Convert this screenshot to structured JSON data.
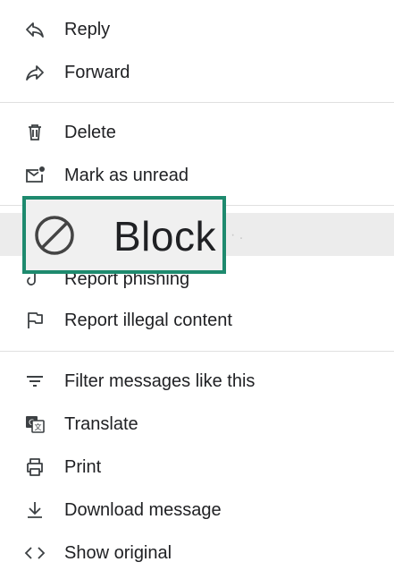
{
  "menu": {
    "items": [
      {
        "label": "Reply",
        "icon": "reply-icon"
      },
      {
        "label": "Forward",
        "icon": "forward-icon"
      },
      {
        "label": "Delete",
        "icon": "trash-icon"
      },
      {
        "label": "Mark as unread",
        "icon": "mark-unread-icon"
      },
      {
        "label": "Block",
        "icon": "block-icon"
      },
      {
        "label": "Report phishing",
        "icon": "phishing-icon"
      },
      {
        "label": "Report illegal content",
        "icon": "flag-icon"
      },
      {
        "label": "Filter messages like this",
        "icon": "filter-icon"
      },
      {
        "label": "Translate",
        "icon": "translate-icon"
      },
      {
        "label": "Print",
        "icon": "print-icon"
      },
      {
        "label": "Download message",
        "icon": "download-icon"
      },
      {
        "label": "Show original",
        "icon": "code-icon"
      }
    ]
  },
  "highlight": {
    "label": "Block",
    "icon": "block-icon",
    "border_color": "#1e8a6e"
  }
}
